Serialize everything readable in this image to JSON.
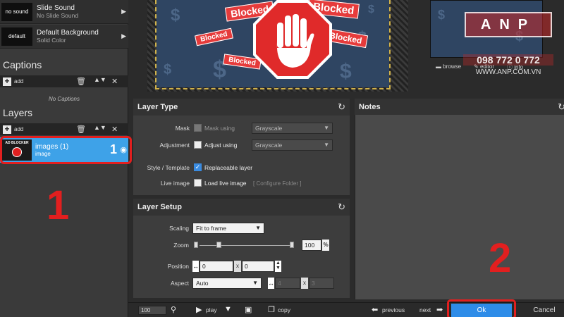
{
  "sidebar": {
    "rows": [
      {
        "thumb": "no sound",
        "title": "Slide Sound",
        "subtitle": "No Slide Sound"
      },
      {
        "thumb": "default",
        "title": "Default Background",
        "subtitle": "Solid Color"
      }
    ],
    "captions": {
      "title": "Captions",
      "add_label": "add",
      "empty": "No Captions"
    },
    "layers": {
      "title": "Layers",
      "add_label": "add",
      "items": [
        {
          "name": "images (1)",
          "type": "image",
          "number": "1",
          "thumb_text": "AD BLOCKER"
        }
      ]
    }
  },
  "annotations": {
    "step1": "1",
    "step2": "2"
  },
  "preview": {
    "banners": [
      "Blocked",
      "Blocked",
      "Blocked",
      "Blocked",
      "Blocked"
    ],
    "right_links": [
      "browse",
      "editor",
      "info"
    ]
  },
  "watermark": {
    "logo": "ANP",
    "phone": "098 772 0 772",
    "url": "WWW.ANP.COM.VN"
  },
  "layer_type": {
    "title": "Layer Type",
    "mask": {
      "label": "Mask",
      "check_label": "Mask using",
      "select": "Grayscale"
    },
    "adjustment": {
      "label": "Adjustment",
      "check_label": "Adjust using",
      "select": "Grayscale"
    },
    "style": {
      "label": "Style / Template",
      "check_label": "Replaceable layer"
    },
    "live": {
      "label": "Live image",
      "check_label": "Load live image",
      "link": "[ Configure Folder ]"
    }
  },
  "notes": {
    "title": "Notes"
  },
  "layer_setup": {
    "title": "Layer Setup",
    "scaling": {
      "label": "Scaling",
      "value": "Fit to frame"
    },
    "zoom": {
      "label": "Zoom",
      "value": "100",
      "unit": "%"
    },
    "position": {
      "label": "Position",
      "x": "0",
      "y": "0",
      "sep": "x"
    },
    "aspect": {
      "label": "Aspect",
      "value": "Auto",
      "w": "4",
      "h": "3",
      "sep": "x"
    }
  },
  "bottom": {
    "zoom_value": "100",
    "play": "play",
    "copy": "copy",
    "previous": "previous",
    "next": "next",
    "ok": "Ok",
    "cancel": "Cancel"
  },
  "colors": {
    "accent": "#3ea2e8",
    "highlight": "#e21f1f",
    "ok_button": "#2e8ce8"
  }
}
